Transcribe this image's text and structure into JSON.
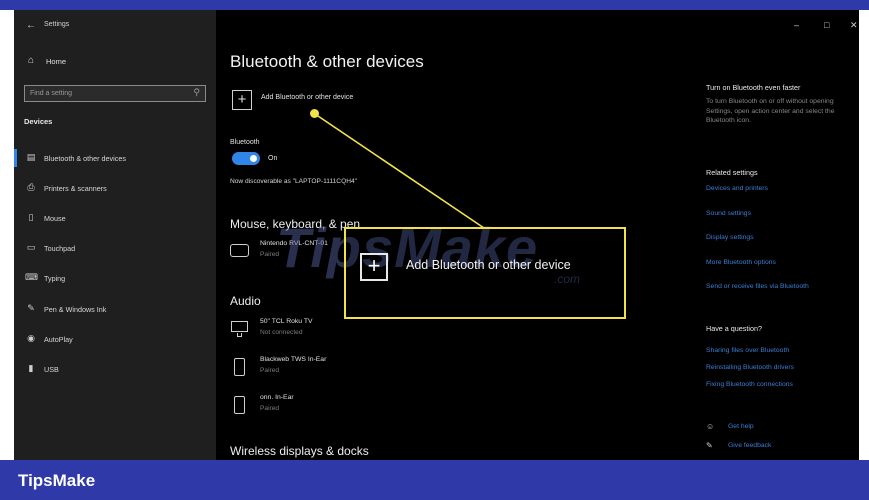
{
  "window": {
    "app_title": "Settings",
    "controls": {
      "minimize": "–",
      "maximize": "□",
      "close": "✕"
    }
  },
  "sidebar": {
    "home_label": "Home",
    "search_placeholder": "Find a setting",
    "section_title": "Devices",
    "items": [
      {
        "label": "Bluetooth & other devices",
        "icon": "bluetooth-devices-icon",
        "active": true
      },
      {
        "label": "Printers & scanners",
        "icon": "printer-icon",
        "active": false
      },
      {
        "label": "Mouse",
        "icon": "mouse-icon",
        "active": false
      },
      {
        "label": "Touchpad",
        "icon": "touchpad-icon",
        "active": false
      },
      {
        "label": "Typing",
        "icon": "keyboard-icon",
        "active": false
      },
      {
        "label": "Pen & Windows Ink",
        "icon": "pen-icon",
        "active": false
      },
      {
        "label": "AutoPlay",
        "icon": "autoplay-icon",
        "active": false
      },
      {
        "label": "USB",
        "icon": "usb-icon",
        "active": false
      }
    ]
  },
  "main": {
    "title": "Bluetooth & other devices",
    "add_device_label": "Add Bluetooth or other device",
    "bluetooth_label": "Bluetooth",
    "toggle_state": "On",
    "discoverable_text": "Now discoverable as \"LAPTOP-1111CQH4\"",
    "sections": {
      "mouse_keyboard": "Mouse, keyboard, & pen",
      "audio": "Audio",
      "wireless": "Wireless displays & docks"
    },
    "devices_mouse": [
      {
        "name": "Nintendo RVL-CNT-01",
        "status": "Paired",
        "icon": "gamepad-icon"
      }
    ],
    "devices_audio": [
      {
        "name": "50\" TCL Roku TV",
        "status": "Not connected",
        "icon": "monitor-icon"
      },
      {
        "name": "Blackweb TWS In-Ear",
        "status": "Paired",
        "icon": "phone-icon"
      },
      {
        "name": "onn. In-Ear",
        "status": "Paired",
        "icon": "phone-icon"
      }
    ]
  },
  "right_pane": {
    "faster_title": "Turn on Bluetooth even faster",
    "faster_text": "To turn Bluetooth on or off without opening Settings, open action center and select the Bluetooth icon.",
    "related_title": "Related settings",
    "related_links": [
      "Devices and printers",
      "Sound settings",
      "Display settings",
      "More Bluetooth options",
      "Send or receive files via Bluetooth"
    ],
    "question_title": "Have a question?",
    "question_links": [
      "Sharing files over Bluetooth",
      "Reinstalling Bluetooth drivers",
      "Fixing Bluetooth connections"
    ],
    "get_help": "Get help",
    "give_feedback": "Give feedback"
  },
  "annotation": {
    "callout_label": "Add Bluetooth or other device",
    "color": "#f2e24a"
  },
  "watermark": {
    "text": "TipsMake",
    "sub": ".com"
  },
  "banner": {
    "brand": "TipsMake",
    "color": "#2f3aa8"
  }
}
